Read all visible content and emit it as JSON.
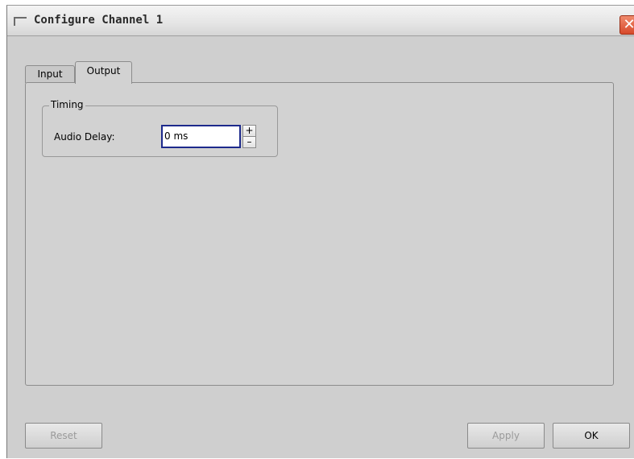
{
  "window": {
    "title": "Configure Channel 1",
    "close_glyph": "✕"
  },
  "tabs": [
    {
      "label": "Input",
      "selected": false
    },
    {
      "label": "Output",
      "selected": true
    }
  ],
  "timing": {
    "group_label": "Timing",
    "audio_delay_label": "Audio Delay:",
    "audio_delay_value": "0 ms",
    "spin_up": "+",
    "spin_down": "–"
  },
  "buttons": {
    "reset": "Reset",
    "apply": "Apply",
    "ok": "OK"
  },
  "colors": {
    "window_bg": "#cfcfcf",
    "close_button": "#d7492a",
    "focus_border": "#1d2a8c"
  }
}
